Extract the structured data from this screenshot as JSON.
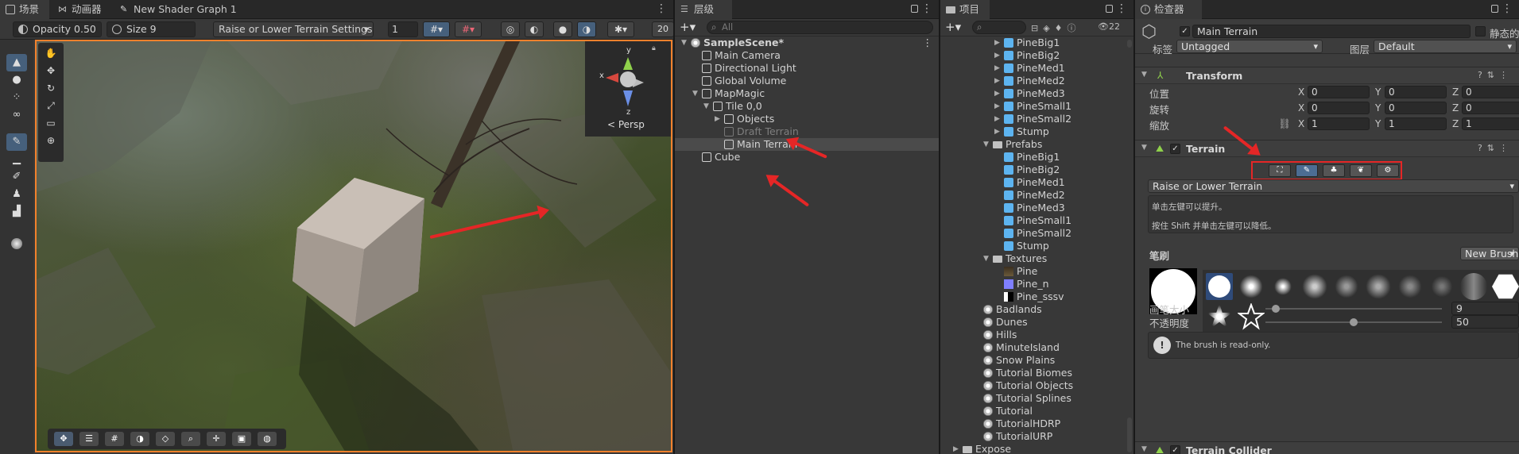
{
  "scene": {
    "tabs": [
      {
        "label": "场景",
        "icon": "scene-icon"
      },
      {
        "label": "动画器",
        "icon": "animator-icon"
      },
      {
        "label": "New Shader Graph 1",
        "icon": "shader-graph-icon"
      }
    ],
    "toolbar": {
      "opacity": "Opacity 0.50",
      "size": "Size 9",
      "mode": "Raise or Lower Terrain Settings",
      "value": "1",
      "zoom_partial": "20"
    },
    "gizmo_label": "< Persp",
    "gizmo_axes": {
      "y": "y",
      "x": "x",
      "z": "z"
    }
  },
  "hierarchy": {
    "tab": "层级",
    "search_placeholder": "All",
    "items": [
      {
        "label": "SampleScene*",
        "depth": 0,
        "type": "scene",
        "expanded": true
      },
      {
        "label": "Main Camera",
        "depth": 1,
        "type": "gameobject"
      },
      {
        "label": "Directional Light",
        "depth": 1,
        "type": "gameobject"
      },
      {
        "label": "Global Volume",
        "depth": 1,
        "type": "gameobject"
      },
      {
        "label": "MapMagic",
        "depth": 1,
        "type": "gameobject",
        "expanded": true
      },
      {
        "label": "Tile 0,0",
        "depth": 2,
        "type": "gameobject",
        "expanded": true
      },
      {
        "label": "Objects",
        "depth": 3,
        "type": "gameobject",
        "collapsed": true
      },
      {
        "label": "Draft Terrain",
        "depth": 3,
        "type": "gameobject",
        "dim": true
      },
      {
        "label": "Main Terrain",
        "depth": 3,
        "type": "gameobject",
        "selected": true
      },
      {
        "label": "Cube",
        "depth": 1,
        "type": "gameobject"
      }
    ]
  },
  "project": {
    "tab": "项目",
    "count": "22",
    "items": [
      {
        "label": "PineBig1",
        "depth": 3,
        "type": "prefab",
        "collapsed": true
      },
      {
        "label": "PineBig2",
        "depth": 3,
        "type": "prefab",
        "collapsed": true
      },
      {
        "label": "PineMed1",
        "depth": 3,
        "type": "prefab",
        "collapsed": true
      },
      {
        "label": "PineMed2",
        "depth": 3,
        "type": "prefab",
        "collapsed": true
      },
      {
        "label": "PineMed3",
        "depth": 3,
        "type": "prefab",
        "collapsed": true
      },
      {
        "label": "PineSmall1",
        "depth": 3,
        "type": "prefab",
        "collapsed": true
      },
      {
        "label": "PineSmall2",
        "depth": 3,
        "type": "prefab",
        "collapsed": true
      },
      {
        "label": "Stump",
        "depth": 3,
        "type": "prefab",
        "collapsed": true
      },
      {
        "label": "Prefabs",
        "depth": 2,
        "type": "folder",
        "expanded": true
      },
      {
        "label": "PineBig1",
        "depth": 3,
        "type": "prefab"
      },
      {
        "label": "PineBig2",
        "depth": 3,
        "type": "prefab"
      },
      {
        "label": "PineMed1",
        "depth": 3,
        "type": "prefab"
      },
      {
        "label": "PineMed2",
        "depth": 3,
        "type": "prefab"
      },
      {
        "label": "PineMed3",
        "depth": 3,
        "type": "prefab"
      },
      {
        "label": "PineSmall1",
        "depth": 3,
        "type": "prefab"
      },
      {
        "label": "PineSmall2",
        "depth": 3,
        "type": "prefab"
      },
      {
        "label": "Stump",
        "depth": 3,
        "type": "prefab"
      },
      {
        "label": "Textures",
        "depth": 2,
        "type": "folder",
        "expanded": true
      },
      {
        "label": "Pine",
        "depth": 3,
        "type": "texture-pine"
      },
      {
        "label": "Pine_n",
        "depth": 3,
        "type": "texture-normal"
      },
      {
        "label": "Pine_sssv",
        "depth": 3,
        "type": "texture-sss"
      },
      {
        "label": "Badlands",
        "depth": 1,
        "type": "unity"
      },
      {
        "label": "Dunes",
        "depth": 1,
        "type": "unity"
      },
      {
        "label": "Hills",
        "depth": 1,
        "type": "unity"
      },
      {
        "label": "MinuteIsland",
        "depth": 1,
        "type": "unity"
      },
      {
        "label": "Snow Plains",
        "depth": 1,
        "type": "unity"
      },
      {
        "label": "Tutorial Biomes",
        "depth": 1,
        "type": "unity"
      },
      {
        "label": "Tutorial Objects",
        "depth": 1,
        "type": "unity"
      },
      {
        "label": "Tutorial Splines",
        "depth": 1,
        "type": "unity"
      },
      {
        "label": "Tutorial",
        "depth": 1,
        "type": "unity"
      },
      {
        "label": "TutorialHDRP",
        "depth": 1,
        "type": "unity"
      },
      {
        "label": "TutorialURP",
        "depth": 1,
        "type": "unity"
      },
      {
        "label": "Expose",
        "depth": 0,
        "type": "folder",
        "collapsed": true
      }
    ]
  },
  "inspector": {
    "tab": "检查器",
    "object_name": "Main Terrain",
    "static_label": "静态的",
    "tag_label": "标签",
    "tag_value": "Untagged",
    "layer_label": "图层",
    "layer_value": "Default",
    "transform": {
      "title": "Transform",
      "rows": [
        {
          "label": "位置",
          "x": "0",
          "y": "0",
          "z": "0"
        },
        {
          "label": "旋转",
          "x": "0",
          "y": "0",
          "z": "0"
        },
        {
          "label": "缩放",
          "x": "1",
          "y": "1",
          "z": "1"
        }
      ]
    },
    "terrain": {
      "title": "Terrain",
      "tool_dropdown": "Raise or Lower Terrain",
      "help_line1": "单击左键可以提升。",
      "help_line2": "按住 Shift 并单击左键可以降低。",
      "brushes_label": "笔刷",
      "new_brush_label": "New Brush...",
      "brush_size_label": "画笔大小",
      "brush_size_value": "9",
      "brush_size_fraction": 0.06,
      "opacity_label": "不透明度",
      "opacity_value": "50",
      "opacity_fraction": 0.5,
      "readonly_note": "The brush is read-only."
    },
    "terrain_collider_title": "Terrain Collider"
  },
  "colors": {
    "accent_blue": "#46607c",
    "selection_orange": "#f2812c",
    "annotation_red": "#e52626",
    "prefab_blue": "#5db4f0"
  }
}
